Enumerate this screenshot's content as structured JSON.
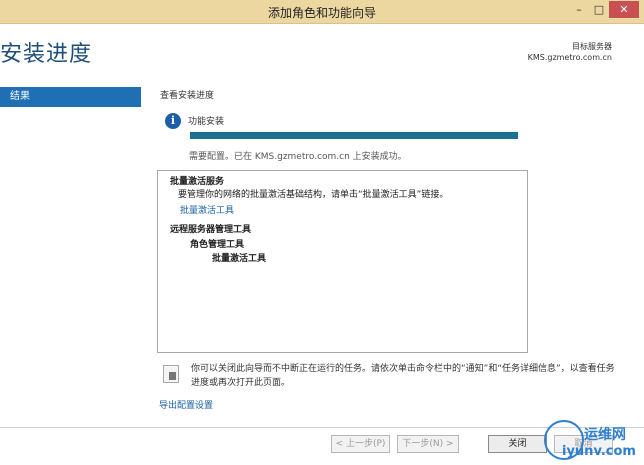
{
  "window": {
    "title": "添加角色和功能向导",
    "minimize": "–",
    "maximize": "□",
    "close": "✕"
  },
  "header": {
    "title": "安装进度",
    "server_label": "目标服务器",
    "server_name": "KMS.gzmetro.com.cn"
  },
  "nav": {
    "items": [
      {
        "label": "结果"
      }
    ]
  },
  "main": {
    "subtitle": "查看安装进度",
    "info_icon": "i",
    "feature_label": "功能安装",
    "progress_percent": 100,
    "status": "需要配置。已在 KMS.gzmetro.com.cn 上安装成功。",
    "results": {
      "line1": "批量激活服务",
      "line2": "要管理你的网络的批量激活基础结构，请单击“批量激活工具”链接。",
      "link": "批量激活工具",
      "line3": "远程服务器管理工具",
      "line4": "角色管理工具",
      "line5": "批量激活工具"
    },
    "note": "你可以关闭此向导而不中断正在运行的任务。请依次单击命令栏中的“通知”和“任务详细信息”，以查看任务进度或再次打开此页面。",
    "export_link": "导出配置设置"
  },
  "footer": {
    "prev": "< 上一步(P)",
    "next": "下一步(N) >",
    "close": "关闭",
    "cancel": "取消"
  },
  "watermark": {
    "text1": "运维网",
    "text2": "iyunv.com"
  },
  "colors": {
    "accent": "#1f6fb5",
    "progress": "#1a7192",
    "link": "#1a5fa8",
    "titlebar": "#ecd7a0"
  }
}
